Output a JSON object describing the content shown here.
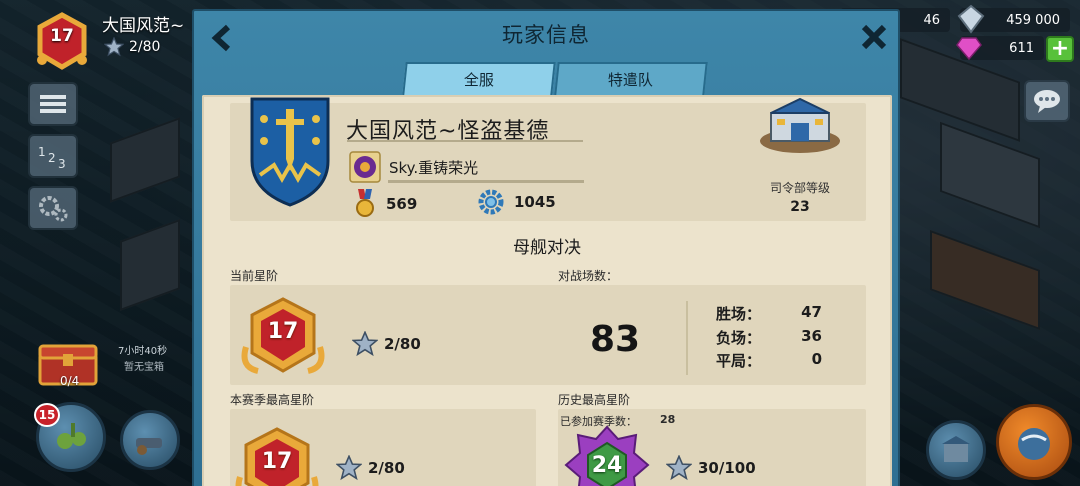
{
  "hud": {
    "level": "17",
    "player_name": "大国风范~",
    "stars": "2/80",
    "resource_left": "46",
    "diamonds": "459 000",
    "gems": "611",
    "plus_label": "+",
    "chest_count": "0/4",
    "chest_timer": "7小时40秒",
    "chest_label": "暂无宝箱",
    "notification_count": "15"
  },
  "modal": {
    "title": "玩家信息",
    "tabs": [
      {
        "label": "全服",
        "active": true
      },
      {
        "label": "特遣队",
        "active": false
      }
    ]
  },
  "profile": {
    "name": "大国风范~怪盗基德",
    "club": "Sky.重铸荣光",
    "medals": "569",
    "power": "1045",
    "hq_label": "司令部等级",
    "hq_level": "23"
  },
  "mothership": {
    "section_title": "母舰对决",
    "current_rank": {
      "label": "当前星阶",
      "level": "17",
      "stars": "2/80"
    },
    "battles": {
      "label": "对战场数：",
      "total": "83",
      "wins_label": "胜场：",
      "wins": "47",
      "losses_label": "负场：",
      "losses": "36",
      "draws_label": "平局：",
      "draws": "0"
    },
    "season_best": {
      "label": "本赛季最高星阶",
      "level": "17",
      "stars": "2/80"
    },
    "history_best": {
      "label": "历史最高星阶",
      "seasons_label": "已参加赛季数：",
      "seasons": "28",
      "level": "24",
      "stars": "30/100"
    }
  },
  "colors": {
    "modal_blue": "#3e86a9",
    "paper": "#ece3cc",
    "panel": "#e0d6bc",
    "badge_gold": "#e9a93a",
    "badge_red": "#c0222a",
    "badge_purple": "#9b3fc0",
    "badge_green": "#3f9a45",
    "plus_green": "#58c13a"
  }
}
